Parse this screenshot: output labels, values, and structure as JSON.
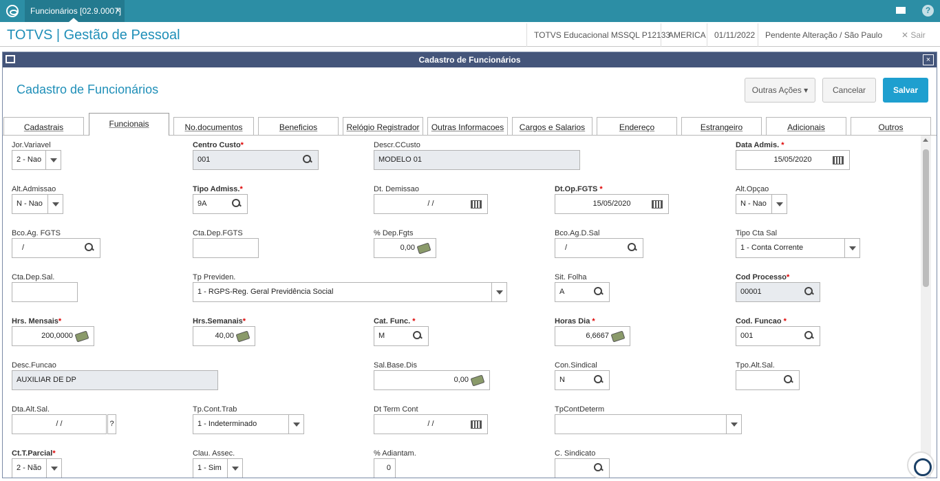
{
  "topbar": {
    "tab_label": "Funcionários [02.9.0007]",
    "tab_close": "×"
  },
  "header": {
    "title": "TOTVS | Gestão de Pessoal",
    "environment": "TOTVS Educacional MSSQL P12133",
    "company": "AMERICA",
    "date": "01/11/2022",
    "status": "Pendente Alteração / São Paulo",
    "exit_label": "Sair"
  },
  "window": {
    "title": "Cadastro de Funcionários",
    "close": "×",
    "page_title": "Cadastro de Funcionários",
    "actions": {
      "other": "Outras Ações",
      "cancel": "Cancelar",
      "save": "Salvar"
    }
  },
  "tabs": [
    "Cadastrais",
    "Funcionais",
    "No.documentos",
    "Beneficios",
    "Relógio Registrador",
    "Outras Informacoes",
    "Cargos e Salarios",
    "Endereço",
    "Estrangeiro",
    "Adicionais",
    "Outros"
  ],
  "active_tab": "Funcionais",
  "fields": {
    "jor_variavel": {
      "label": "Jor.Variavel",
      "value": "2 - Nao"
    },
    "centro_custo": {
      "label": "Centro Custo",
      "req": "*",
      "value": "001"
    },
    "descr_ccusto": {
      "label": "Descr.CCusto",
      "value": "MODELO 01"
    },
    "data_admis": {
      "label": "Data Admis.",
      "req": "*",
      "value": "15/05/2020"
    },
    "alt_admissao": {
      "label": "Alt.Admissao",
      "value": "N - Nao"
    },
    "tipo_admiss": {
      "label": "Tipo Admiss.",
      "req": "*",
      "value": "9A"
    },
    "dt_demissao": {
      "label": "Dt. Demissao",
      "value": "/  /"
    },
    "dt_op_fgts": {
      "label": "Dt.Op.FGTS",
      "req": "*",
      "value": "15/05/2020"
    },
    "alt_opcao": {
      "label": "Alt.Opçao",
      "value": "N - Nao"
    },
    "bco_ag_fgts": {
      "label": "Bco.Ag. FGTS",
      "value": "/"
    },
    "cta_dep_fgts": {
      "label": "Cta.Dep.FGTS",
      "value": ""
    },
    "pct_dep_fgts": {
      "label": "% Dep.Fgts",
      "value": "0,00"
    },
    "bco_ag_d_sal": {
      "label": "Bco.Ag.D.Sal",
      "value": "/"
    },
    "tipo_cta_sal": {
      "label": "Tipo Cta Sal",
      "value": "1 - Conta Corrente"
    },
    "cta_dep_sal": {
      "label": "Cta.Dep.Sal.",
      "value": ""
    },
    "tp_previden": {
      "label": "Tp Previden.",
      "value": "1 - RGPS-Reg. Geral Previdência Social"
    },
    "sit_folha": {
      "label": "Sit. Folha",
      "value": "A"
    },
    "cod_processo": {
      "label": "Cod Processo",
      "req": "*",
      "value": "00001"
    },
    "hrs_mensais": {
      "label": "Hrs. Mensais",
      "req": "*",
      "value": "200,0000"
    },
    "hrs_semanais": {
      "label": "Hrs.Semanais",
      "req": "*",
      "value": "40,00"
    },
    "cat_func": {
      "label": "Cat. Func.",
      "req": "*",
      "value": "M"
    },
    "horas_dia": {
      "label": "Horas Dia",
      "req": "*",
      "value": "6,6667"
    },
    "cod_funcao": {
      "label": "Cod. Funcao",
      "req": "*",
      "value": "001"
    },
    "desc_funcao": {
      "label": "Desc.Funcao",
      "value": "AUXILIAR DE DP"
    },
    "sal_base_dis": {
      "label": "Sal.Base.Dis",
      "value": "0,00"
    },
    "con_sindical": {
      "label": "Con.Sindical",
      "value": "N"
    },
    "tpo_alt_sal": {
      "label": "Tpo.Alt.Sal.",
      "value": ""
    },
    "dta_alt_sal": {
      "label": "Dta.Alt.Sal.",
      "value": "/  /",
      "help": "?"
    },
    "tp_cont_trab": {
      "label": "Tp.Cont.Trab",
      "value": "1 - Indeterminado"
    },
    "dt_term_cont": {
      "label": "Dt Term Cont",
      "value": "/  /"
    },
    "tp_cont_determ": {
      "label": "TpContDeterm",
      "value": ""
    },
    "ct_t_parcial": {
      "label": "Ct.T.Parcial",
      "req": "*",
      "value": "2 - Não"
    },
    "clau_assec": {
      "label": "Clau. Assec.",
      "value": "1 - Sim"
    },
    "pct_adiantam": {
      "label": "% Adiantam.",
      "value": "0"
    },
    "c_sindicato": {
      "label": "C. Sindicato",
      "value": ""
    }
  }
}
